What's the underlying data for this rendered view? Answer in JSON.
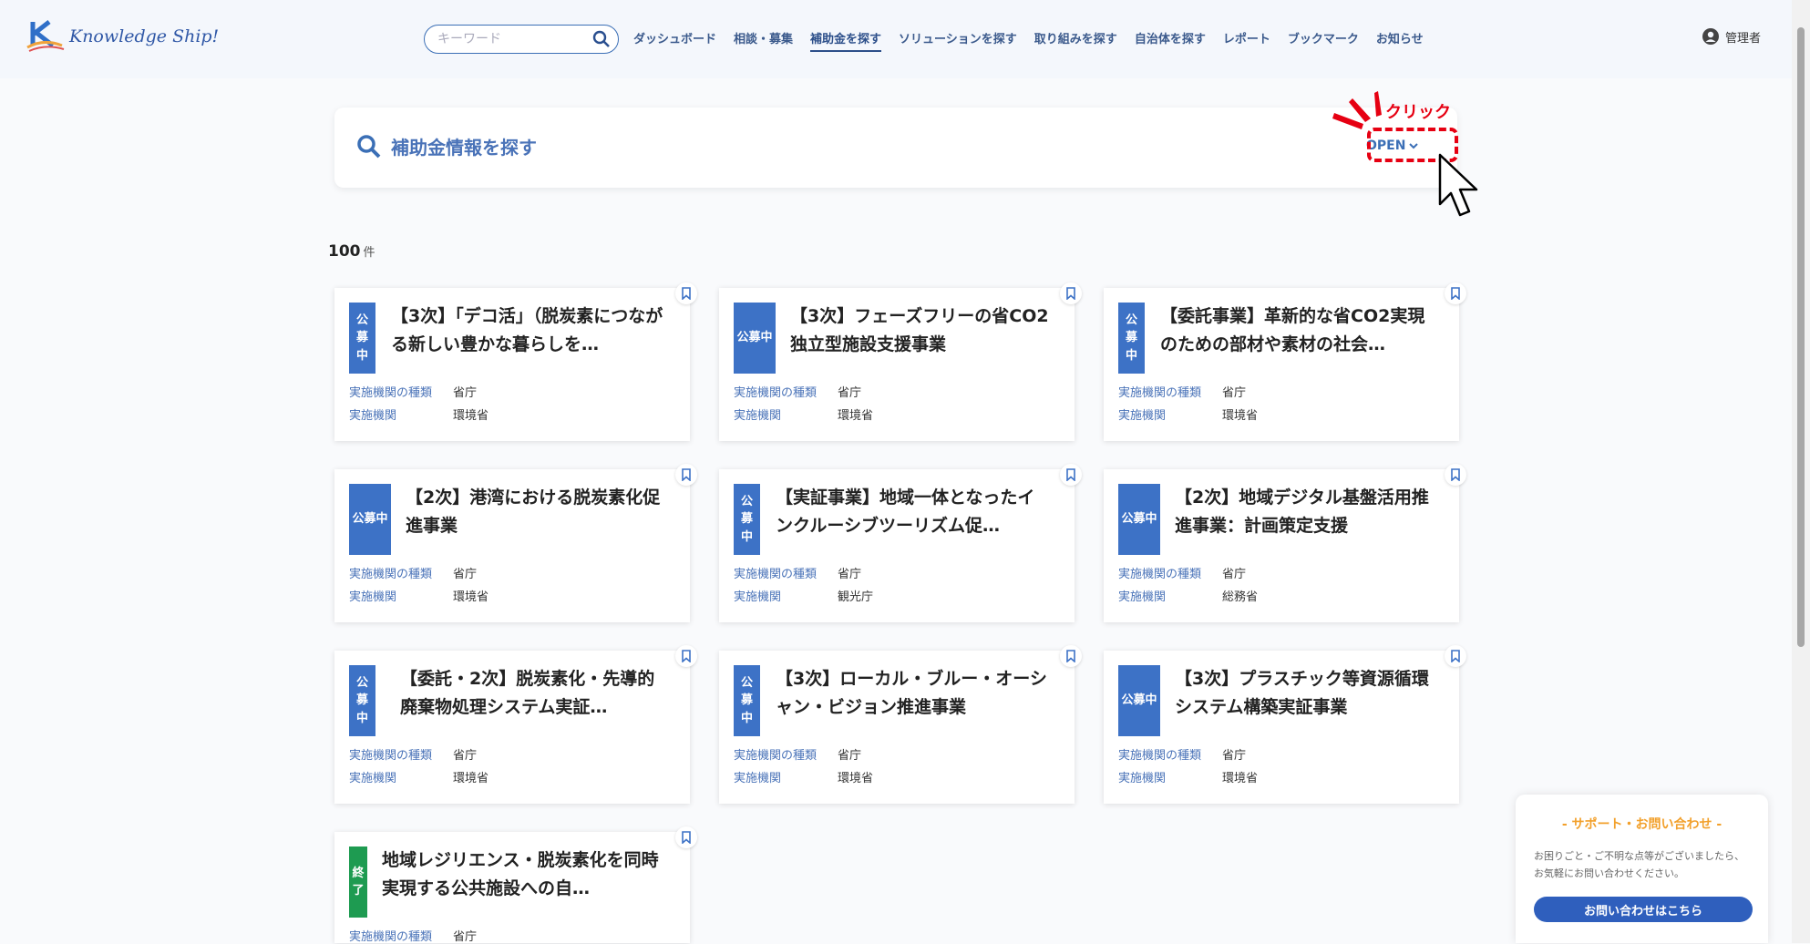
{
  "header": {
    "logo_text": "Knowledge Ship!",
    "search_placeholder": "キーワード",
    "nav": [
      "ダッシュボード",
      "相談・募集",
      "補助金を探す",
      "ソリューションを探す",
      "取り組みを探す",
      "自治体を探す",
      "レポート",
      "ブックマーク",
      "お知らせ"
    ],
    "active_nav": "補助金を探す",
    "user": "管理者"
  },
  "panel": {
    "title": "補助金情報を探す",
    "open_label": "OPEN",
    "click_annotation": "クリック"
  },
  "results": {
    "count": "100",
    "unit": "件"
  },
  "meta_labels": {
    "type": "実施機関の種類",
    "org": "実施機関"
  },
  "cards": [
    {
      "status": "公募中",
      "title": "【3次】「デコ活」（脱炭素につながる新しい豊かな暮らしを…",
      "type": "省庁",
      "org": "環境省"
    },
    {
      "status": "公募中",
      "title": "【3次】フェーズフリーの省CO2独立型施設支援事業",
      "type": "省庁",
      "org": "環境省"
    },
    {
      "status": "公募中",
      "title": "【委託事業】革新的な省CO2実現のための部材や素材の社会…",
      "type": "省庁",
      "org": "環境省"
    },
    {
      "status": "公募中",
      "title": "【2次】港湾における脱炭素化促進事業",
      "type": "省庁",
      "org": "環境省"
    },
    {
      "status": "公募中",
      "title": "【実証事業】地域一体となったインクルーシブツーリズム促…",
      "type": "省庁",
      "org": "観光庁"
    },
    {
      "status": "公募中",
      "title": "【2次】地域デジタル基盤活用推進事業：計画策定支援",
      "type": "省庁",
      "org": "総務省"
    },
    {
      "status": "公募中",
      "title": "【委託・2次】脱炭素化・先導的廃棄物処理システム実証…",
      "type": "省庁",
      "org": "環境省"
    },
    {
      "status": "公募中",
      "title": "【3次】ローカル・ブルー・オーシャン・ビジョン推進事業",
      "type": "省庁",
      "org": "環境省"
    },
    {
      "status": "公募中",
      "title": "【3次】プラスチック等資源循環システム構築実証事業",
      "type": "省庁",
      "org": "環境省"
    },
    {
      "status": "終了",
      "title": "地域レジリエンス・脱炭素化を同時実現する公共施設への自…",
      "type": "省庁",
      "org": ""
    }
  ],
  "support": {
    "title": "- サポート・お問い合わせ -",
    "text": "お困りごと・ご不明な点等がございましたら、お気軽にお問い合わせください。",
    "button": "お問い合わせはこちら"
  },
  "colors": {
    "accent": "#3d72c6",
    "status_open": "#3d72c6",
    "status_closed": "#1e9b51",
    "annotation": "#e60012",
    "support_title": "#f2a02b"
  }
}
